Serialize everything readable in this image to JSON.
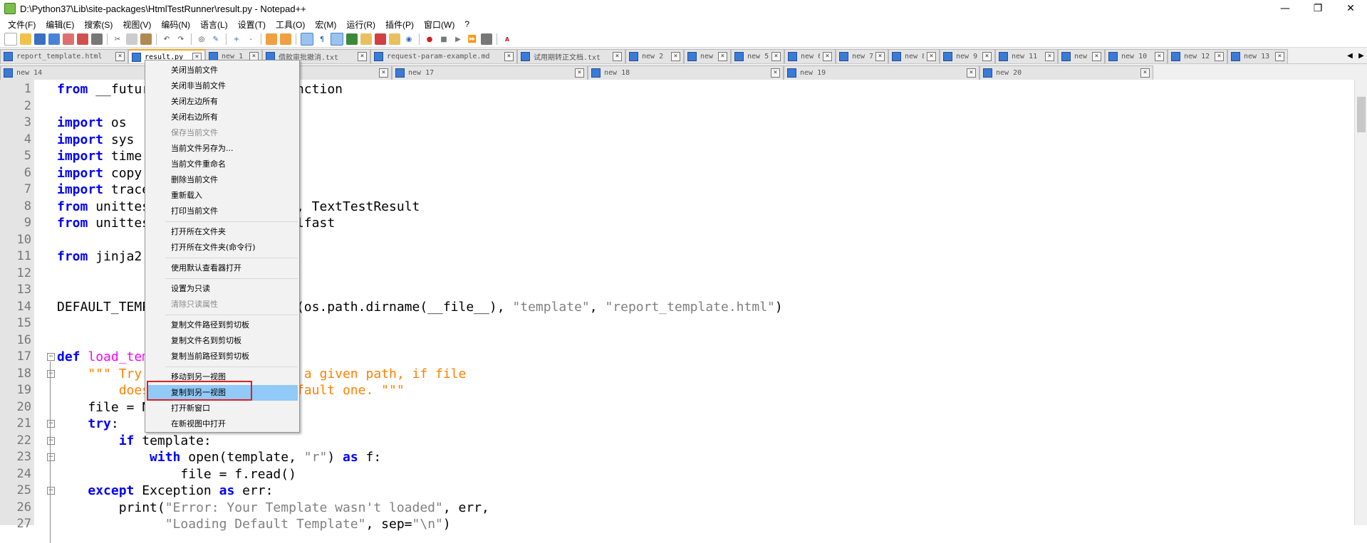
{
  "window": {
    "title": "D:\\Python37\\Lib\\site-packages\\HtmlTestRunner\\result.py - Notepad++"
  },
  "menu": [
    "文件(F)",
    "编辑(E)",
    "搜索(S)",
    "视图(V)",
    "编码(N)",
    "语言(L)",
    "设置(T)",
    "工具(O)",
    "宏(M)",
    "运行(R)",
    "插件(P)",
    "窗口(W)",
    "?"
  ],
  "tabs_row1": [
    {
      "label": "report_template.html",
      "active": false
    },
    {
      "label": "result.py",
      "active": true
    },
    {
      "label": "new 1",
      "active": false
    },
    {
      "label": "借款审批撤消.txt",
      "active": false
    },
    {
      "label": "request-param-example.md",
      "active": false
    },
    {
      "label": "试用期转正文档.txt",
      "active": false
    },
    {
      "label": "new 2",
      "active": false
    },
    {
      "label": "new 4",
      "active": false
    },
    {
      "label": "new 5",
      "active": false
    },
    {
      "label": "new 6",
      "active": false
    },
    {
      "label": "new 7",
      "active": false
    },
    {
      "label": "new 8",
      "active": false
    },
    {
      "label": "new 9",
      "active": false
    },
    {
      "label": "new 11",
      "active": false
    },
    {
      "label": "new 3",
      "active": false
    },
    {
      "label": "new 10",
      "active": false
    },
    {
      "label": "new 12",
      "active": false
    },
    {
      "label": "new 13",
      "active": false
    }
  ],
  "tabs_row2": [
    {
      "label": "new 14"
    },
    {
      "label": "new 16"
    },
    {
      "label": "new 17"
    },
    {
      "label": "new 18"
    },
    {
      "label": "new 19"
    },
    {
      "label": "new 20"
    }
  ],
  "code_lines": [
    "from __future__ import print_function",
    "",
    "import os",
    "import sys",
    "import time",
    "import copy",
    "import traceback",
    "from unittest import TestResult, TextTestResult",
    "from unittest.result import failfast",
    "",
    "from jinja2 import Template",
    "",
    "",
    "DEFAULT_TEMPLATE = os.path.join(os.path.dirname(__file__), \"template\", \"report_template.html\")",
    "",
    "",
    "def load_template(template):",
    "    \"\"\" Try to read a file from a given path, if file",
    "        does not exist, load default one. \"\"\"",
    "    file = None",
    "    try:",
    "        if template:",
    "            with open(template, \"r\") as f:",
    "                file = f.read()",
    "    except Exception as err:",
    "        print(\"Error: Your Template wasn't loaded\", err,",
    "              \"Loading Default Template\", sep=\"\\n\")"
  ],
  "context_menu": [
    {
      "label": "关闭当前文件",
      "disabled": false
    },
    {
      "label": "关闭非当前文件",
      "disabled": false
    },
    {
      "label": "关闭左边所有",
      "disabled": false
    },
    {
      "label": "关闭右边所有",
      "disabled": false
    },
    {
      "label": "保存当前文件",
      "disabled": true
    },
    {
      "label": "当前文件另存为...",
      "disabled": false
    },
    {
      "label": "当前文件重命名",
      "disabled": false
    },
    {
      "label": "删除当前文件",
      "disabled": false
    },
    {
      "label": "重新载入",
      "disabled": false
    },
    {
      "label": "打印当前文件",
      "disabled": false
    },
    {
      "sep": true
    },
    {
      "label": "打开所在文件夹",
      "disabled": false
    },
    {
      "label": "打开所在文件夹(命令行)",
      "disabled": false
    },
    {
      "sep": true
    },
    {
      "label": "使用默认查看器打开",
      "disabled": false
    },
    {
      "sep": true
    },
    {
      "label": "设置为只读",
      "disabled": false
    },
    {
      "label": "清除只读属性",
      "disabled": true
    },
    {
      "sep": true
    },
    {
      "label": "复制文件路径到剪切板",
      "disabled": false
    },
    {
      "label": "复制文件名到剪切板",
      "disabled": false
    },
    {
      "label": "复制当前路径到剪切板",
      "disabled": false
    },
    {
      "sep": true
    },
    {
      "label": "移动到另一视图",
      "disabled": false
    },
    {
      "label": "复制到另一视图",
      "disabled": false,
      "highlighted": true
    },
    {
      "label": "打开新窗口",
      "disabled": false
    },
    {
      "label": "在新视图中打开",
      "disabled": false
    }
  ],
  "colors": {
    "keyword": "#0000ff",
    "function": "#ff00ff",
    "string": "#808080",
    "docstring": "#ff8000",
    "menu_highlight": "#91c9f7",
    "callout": "#e02020"
  }
}
